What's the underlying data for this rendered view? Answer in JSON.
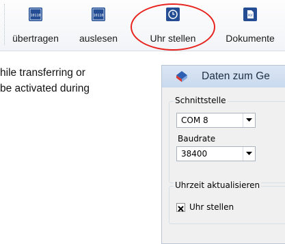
{
  "toolbar": {
    "buttons": [
      {
        "label": "übertragen",
        "icon": "transfer-device-icon"
      },
      {
        "label": "auslesen",
        "icon": "read-device-icon"
      },
      {
        "label": "Uhr stellen",
        "icon": "clock-icon"
      },
      {
        "label": "Dokumente",
        "icon": "pdf-document-icon"
      }
    ],
    "highlighted_button": "Uhr stellen"
  },
  "doc_text": {
    "line1": "hile transferring or",
    "line2": "be activated during"
  },
  "dialog": {
    "title": "Daten zum Ge",
    "interface_group": {
      "legend": "Schnittstelle",
      "port_value": "COM 8",
      "baud_label": "Baudrate",
      "baud_value": "38400"
    },
    "time_group": {
      "legend": "Uhrzeit aktualisieren",
      "checkbox_label": "Uhr stellen",
      "checkbox_checked": true
    }
  },
  "colors": {
    "highlight": "#e8221d",
    "icon_blue": "#244d93",
    "titlebar": "#cfdcef"
  }
}
